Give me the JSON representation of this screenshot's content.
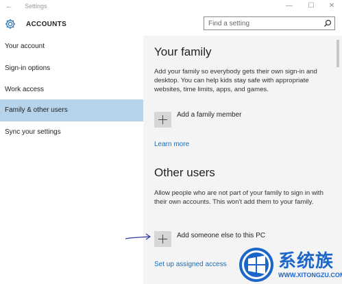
{
  "window": {
    "title": "Settings",
    "back_glyph": "←",
    "min_glyph": "—",
    "max_glyph": "☐",
    "close_glyph": "✕"
  },
  "header": {
    "title": "ACCOUNTS",
    "icon": "gear-icon"
  },
  "search": {
    "placeholder": "Find a setting",
    "icon": "search-icon"
  },
  "sidebar": {
    "items": [
      {
        "label": "Your account",
        "active": false
      },
      {
        "label": "Sign-in options",
        "active": false
      },
      {
        "label": "Work access",
        "active": false
      },
      {
        "label": "Family & other users",
        "active": true
      },
      {
        "label": "Sync your settings",
        "active": false
      }
    ]
  },
  "family": {
    "heading": "Your family",
    "description": "Add your family so everybody gets their own sign-in and desktop. You can help kids stay safe with appropriate websites, time limits, apps, and games.",
    "add_label": "Add a family member",
    "learn_more": "Learn more"
  },
  "other_users": {
    "heading": "Other users",
    "description": "Allow people who are not part of your family to sign in with their own accounts. This won't add them to your family.",
    "add_label": "Add someone else to this PC",
    "assigned_access": "Set up assigned access"
  },
  "watermark": {
    "text": "系统族",
    "url": "WWW.XITONGZU.COM"
  },
  "colors": {
    "accent": "#1a6cb5",
    "active_nav": "#b5d4ec",
    "annotation_arrow": "#2a3aa0"
  }
}
